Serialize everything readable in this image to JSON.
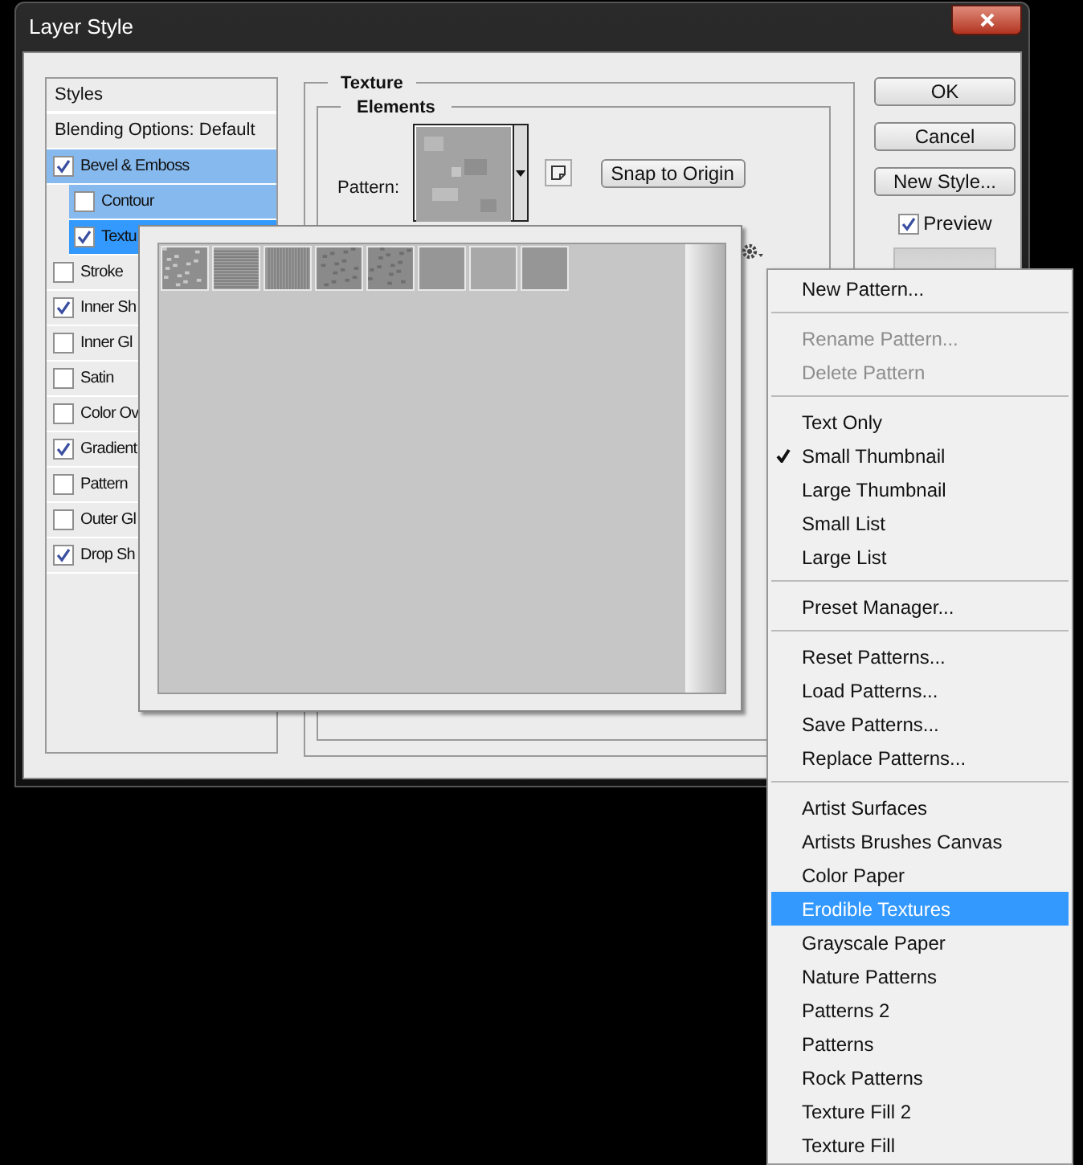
{
  "window": {
    "title": "Layer Style"
  },
  "styles": {
    "header": "Styles",
    "blending": "Blending Options: Default",
    "items": [
      {
        "label": "Bevel & Emboss",
        "checked": true,
        "selected": false,
        "children": [
          {
            "label": "Contour",
            "checked": false,
            "selected": false
          },
          {
            "label": "Textu",
            "checked": true,
            "selected": true
          }
        ]
      },
      {
        "label": "Stroke",
        "checked": false,
        "selected": false
      },
      {
        "label": "Inner Sh",
        "checked": true,
        "selected": false
      },
      {
        "label": "Inner Gl",
        "checked": false,
        "selected": false
      },
      {
        "label": "Satin",
        "checked": false,
        "selected": false
      },
      {
        "label": "Color Ov",
        "checked": false,
        "selected": false
      },
      {
        "label": "Gradient",
        "checked": true,
        "selected": false
      },
      {
        "label": "Pattern",
        "checked": false,
        "selected": false
      },
      {
        "label": "Outer Gl",
        "checked": false,
        "selected": false
      },
      {
        "label": "Drop Sh",
        "checked": true,
        "selected": false
      }
    ]
  },
  "texture": {
    "title": "Texture",
    "elements_title": "Elements",
    "pattern_label": "Pattern:",
    "snap_button": "Snap to Origin"
  },
  "buttons": {
    "ok": "OK",
    "cancel": "Cancel",
    "new_style": "New Style...",
    "preview": {
      "label": "Preview",
      "checked": true
    }
  },
  "pattern_picker": {
    "patterns": [
      {
        "kind": "noise"
      },
      {
        "kind": "horizontal"
      },
      {
        "kind": "vertical"
      },
      {
        "kind": "speckle"
      },
      {
        "kind": "speckle"
      },
      {
        "kind": "flat"
      },
      {
        "kind": "light"
      },
      {
        "kind": "flat"
      }
    ]
  },
  "menu": {
    "groups": [
      [
        {
          "label": "New Pattern...",
          "disabled": false,
          "checked": false,
          "selected": false
        }
      ],
      [
        {
          "label": "Rename Pattern...",
          "disabled": true,
          "checked": false,
          "selected": false
        },
        {
          "label": "Delete Pattern",
          "disabled": true,
          "checked": false,
          "selected": false
        }
      ],
      [
        {
          "label": "Text Only",
          "disabled": false,
          "checked": false,
          "selected": false
        },
        {
          "label": "Small Thumbnail",
          "disabled": false,
          "checked": true,
          "selected": false
        },
        {
          "label": "Large Thumbnail",
          "disabled": false,
          "checked": false,
          "selected": false
        },
        {
          "label": "Small List",
          "disabled": false,
          "checked": false,
          "selected": false
        },
        {
          "label": "Large List",
          "disabled": false,
          "checked": false,
          "selected": false
        }
      ],
      [
        {
          "label": "Preset Manager...",
          "disabled": false,
          "checked": false,
          "selected": false
        }
      ],
      [
        {
          "label": "Reset Patterns...",
          "disabled": false,
          "checked": false,
          "selected": false
        },
        {
          "label": "Load Patterns...",
          "disabled": false,
          "checked": false,
          "selected": false
        },
        {
          "label": "Save Patterns...",
          "disabled": false,
          "checked": false,
          "selected": false
        },
        {
          "label": "Replace Patterns...",
          "disabled": false,
          "checked": false,
          "selected": false
        }
      ],
      [
        {
          "label": "Artist Surfaces",
          "disabled": false,
          "checked": false,
          "selected": false
        },
        {
          "label": "Artists Brushes Canvas",
          "disabled": false,
          "checked": false,
          "selected": false
        },
        {
          "label": "Color Paper",
          "disabled": false,
          "checked": false,
          "selected": false
        },
        {
          "label": "Erodible Textures",
          "disabled": false,
          "checked": false,
          "selected": true
        },
        {
          "label": "Grayscale Paper",
          "disabled": false,
          "checked": false,
          "selected": false
        },
        {
          "label": "Nature Patterns",
          "disabled": false,
          "checked": false,
          "selected": false
        },
        {
          "label": "Patterns 2",
          "disabled": false,
          "checked": false,
          "selected": false
        },
        {
          "label": "Patterns",
          "disabled": false,
          "checked": false,
          "selected": false
        },
        {
          "label": "Rock Patterns",
          "disabled": false,
          "checked": false,
          "selected": false
        },
        {
          "label": "Texture Fill 2",
          "disabled": false,
          "checked": false,
          "selected": false
        },
        {
          "label": "Texture Fill",
          "disabled": false,
          "checked": false,
          "selected": false
        }
      ]
    ]
  }
}
